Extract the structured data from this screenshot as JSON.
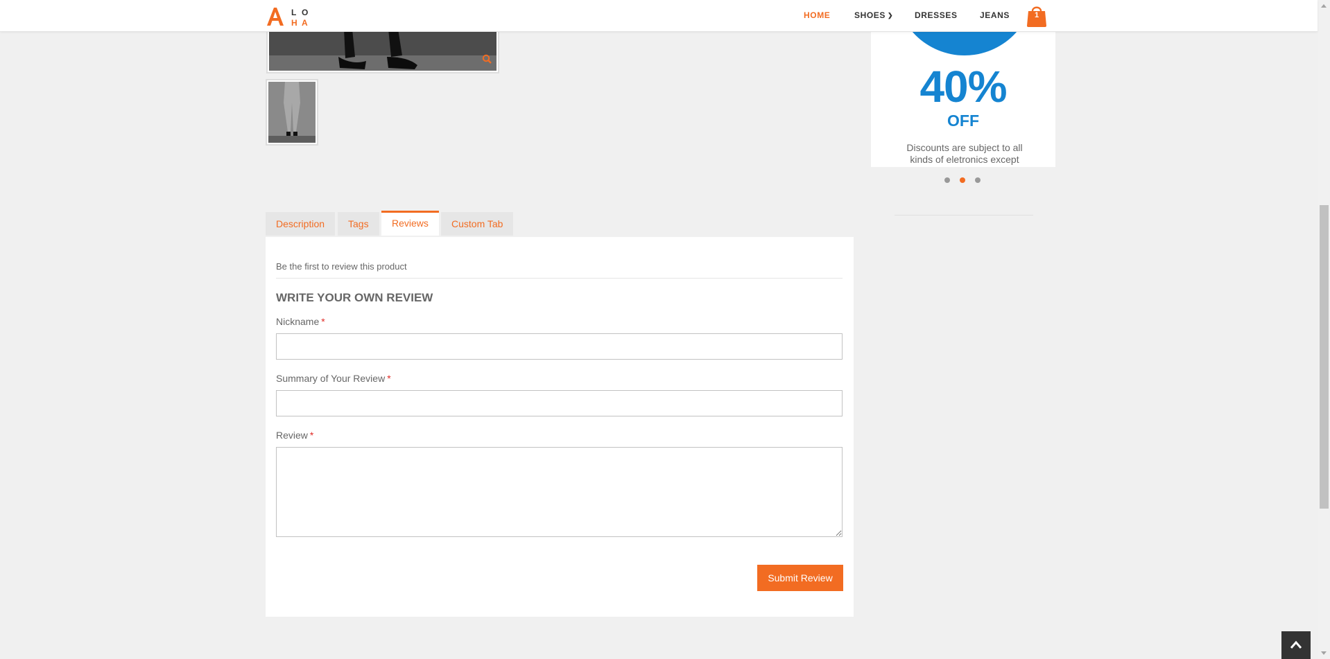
{
  "header": {
    "logo_text": "ALOHA",
    "nav": [
      {
        "label": "HOME",
        "active": true
      },
      {
        "label": "SHOES",
        "has_dropdown": true
      },
      {
        "label": "DRESSES"
      },
      {
        "label": "JEANS"
      }
    ],
    "cart_count": "1"
  },
  "promo": {
    "percent": "40%",
    "off": "OFF",
    "text": "Discounts are subject to all kinds of eletronics except",
    "slides": 3,
    "active_slide": 2
  },
  "tabs": [
    {
      "label": "Description"
    },
    {
      "label": "Tags"
    },
    {
      "label": "Reviews",
      "active": true
    },
    {
      "label": "Custom Tab"
    }
  ],
  "reviews": {
    "first_review_text": "Be the first to review this product",
    "form_title": "Write Your Own Review",
    "nickname_label": "Nickname",
    "summary_label": "Summary of Your Review",
    "review_label": "Review",
    "required_mark": "*",
    "nickname_value": "",
    "summary_value": "",
    "review_value": "",
    "submit_label": "Submit Review"
  },
  "colors": {
    "accent": "#f26c22",
    "promo_blue": "#1584d1",
    "required": "#e02b27"
  },
  "icons": [
    "logo",
    "chevron-down-icon",
    "shopping-bag-icon",
    "search-icon",
    "arrow-up-icon"
  ]
}
